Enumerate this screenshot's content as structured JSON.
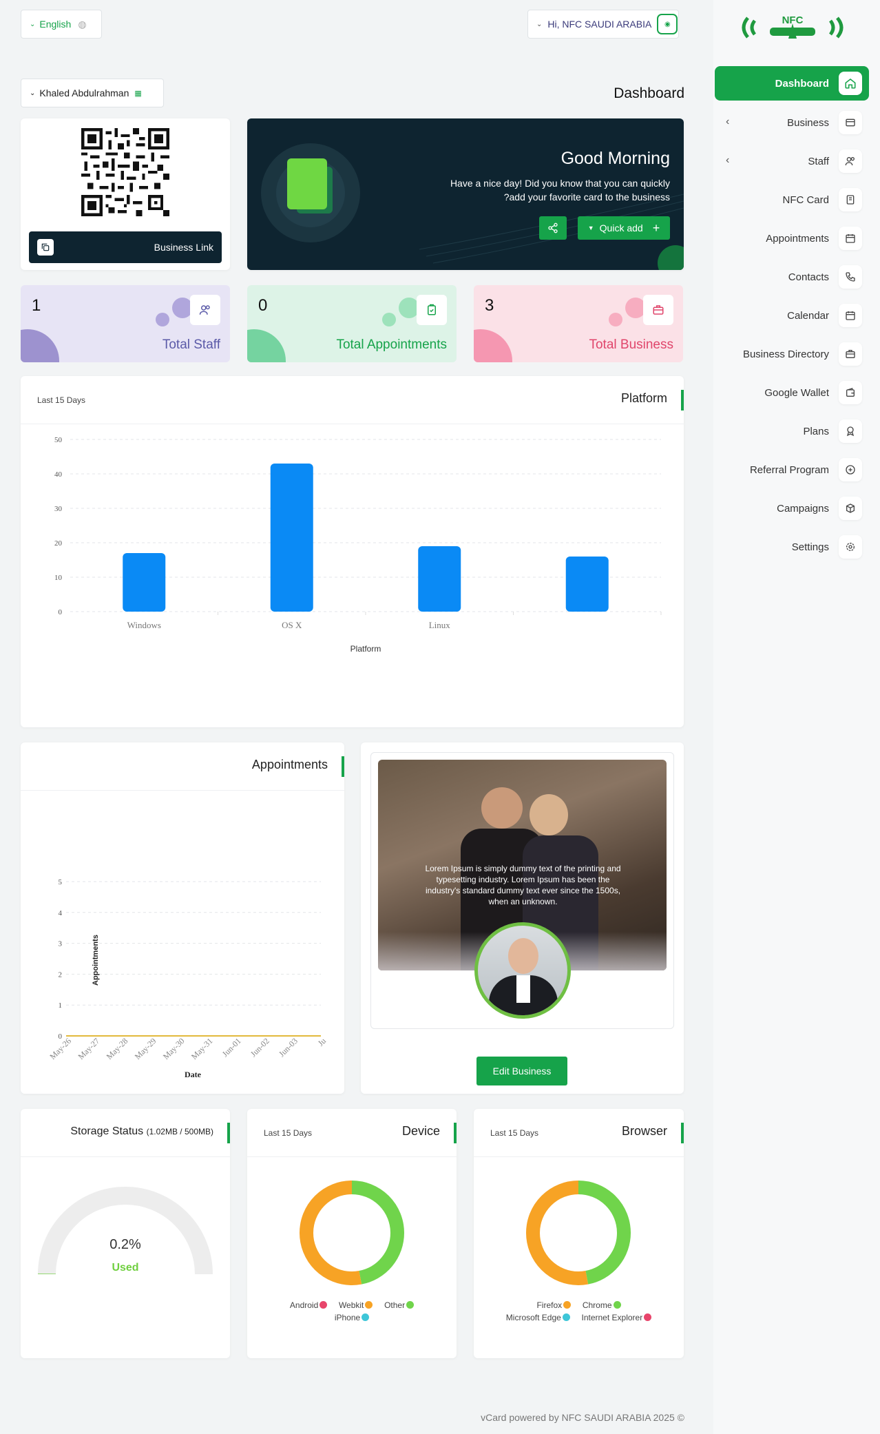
{
  "topbar": {
    "language": "English",
    "greeting": "Hi, NFC SAUDI ARABIA",
    "logo_text": "NFC"
  },
  "user_select": {
    "value": "Khaled Abdulrahman"
  },
  "page_title": "Dashboard",
  "qr_card": {
    "button_label": "Business Link"
  },
  "welcome": {
    "title": "Good Morning",
    "line1": "Have a nice day! Did you know that you can quickly",
    "line2": "?add your favorite card to the business",
    "quick_add": "Quick add"
  },
  "stats": [
    {
      "count": "1",
      "label": "Total Staff",
      "icon": "users-icon",
      "color": "#5b5aa8"
    },
    {
      "count": "0",
      "label": "Total Appointments",
      "icon": "clipboard-check-icon",
      "color": "#16a34a"
    },
    {
      "count": "3",
      "label": "Total Business",
      "icon": "briefcase-icon",
      "color": "#e0456b"
    }
  ],
  "sidebar": {
    "items": [
      {
        "label": "Dashboard",
        "icon": "home-icon",
        "active": true
      },
      {
        "label": "Business",
        "icon": "card-icon",
        "has_children": true
      },
      {
        "label": "Staff",
        "icon": "users-icon",
        "has_children": true
      },
      {
        "label": "NFC Card",
        "icon": "nfc-card-icon"
      },
      {
        "label": "Appointments",
        "icon": "calendar-clock-icon"
      },
      {
        "label": "Contacts",
        "icon": "phone-icon"
      },
      {
        "label": "Calendar",
        "icon": "calendar-icon"
      },
      {
        "label": "Business Directory",
        "icon": "briefcase-icon"
      },
      {
        "label": "Google Wallet",
        "icon": "wallet-icon"
      },
      {
        "label": "Plans",
        "icon": "award-icon"
      },
      {
        "label": "Referral Program",
        "icon": "referral-icon"
      },
      {
        "label": "Campaigns",
        "icon": "box-icon"
      },
      {
        "label": "Settings",
        "icon": "gear-icon"
      }
    ]
  },
  "platform_card": {
    "title": "Platform",
    "subtitle": "Last 15 Days"
  },
  "chart_data": [
    {
      "type": "bar",
      "title": "Platform",
      "categories": [
        "Windows",
        "OS X",
        "Linux",
        ""
      ],
      "values": [
        17,
        43,
        19,
        16
      ],
      "xlabel": "Platform",
      "ylabel": "",
      "ylim": [
        0,
        50
      ],
      "yticks": [
        0,
        10,
        20,
        30,
        40,
        50
      ],
      "color": "#0a8af5",
      "grid": true
    },
    {
      "type": "line",
      "title": "Appointments",
      "x": [
        "May-26",
        "May-27",
        "May-28",
        "May-29",
        "May-30",
        "May-31",
        "Jun-01",
        "Jun-02",
        "Jun-03",
        "Ju"
      ],
      "values": [
        0,
        0,
        0,
        0,
        0,
        0,
        0,
        0,
        0,
        0
      ],
      "xlabel": "Date",
      "ylabel": "Appointments",
      "ylim": [
        0,
        5
      ],
      "yticks": [
        0,
        1,
        2,
        3,
        4,
        5
      ],
      "color": "#e2b93b",
      "grid": true
    },
    {
      "type": "pie",
      "title": "Device",
      "labels": [
        "Android",
        "Webkit",
        "Other",
        "iPhone"
      ],
      "values": [
        0,
        53,
        47,
        0
      ],
      "colors": [
        "#e8456b",
        "#f7a325",
        "#70d44b",
        "#3ec6d8"
      ]
    },
    {
      "type": "pie",
      "title": "Browser",
      "labels": [
        "Firefox",
        "Chrome",
        "Microsoft Edge",
        "Internet Explorer"
      ],
      "values": [
        53,
        47,
        0,
        0
      ],
      "colors": [
        "#f7a325",
        "#70d44b",
        "#3ec6d8",
        "#e8456b"
      ]
    }
  ],
  "appointments_card": {
    "title": "Appointments"
  },
  "business_card": {
    "overlay_text": "Lorem Ipsum is simply dummy text of the printing and typesetting industry. Lorem Ipsum has been the industry's standard dummy text ever since the 1500s, when an unknown.",
    "edit_button": "Edit Business"
  },
  "storage": {
    "title": "Storage Status",
    "usage": "(1.02MB / 500MB)",
    "percent_text": "0.2%",
    "percent": 0.2,
    "used_label": "Used"
  },
  "device_card": {
    "title": "Device",
    "subtitle": "Last 15 Days"
  },
  "browser_card": {
    "title": "Browser",
    "subtitle": "Last 15 Days"
  },
  "footer": {
    "text": "vCard powered by NFC SAUDI ARABIA 2025 ©"
  }
}
